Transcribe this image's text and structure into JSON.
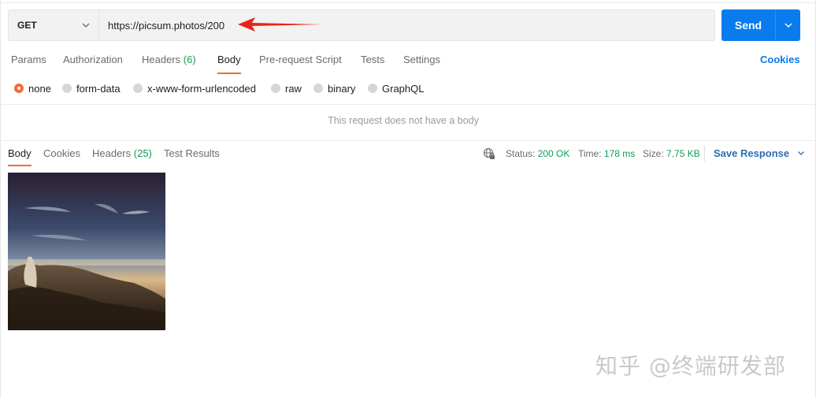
{
  "request": {
    "method": "GET",
    "url": "https://picsum.photos/200",
    "send_label": "Send"
  },
  "request_tabs": {
    "params": "Params",
    "authorization": "Authorization",
    "headers": "Headers",
    "headers_count": "(6)",
    "body": "Body",
    "prerequest": "Pre-request Script",
    "tests": "Tests",
    "settings": "Settings"
  },
  "cookies_link": "Cookies",
  "body_types": {
    "none": "none",
    "form_data": "form-data",
    "urlencoded": "x-www-form-urlencoded",
    "raw": "raw",
    "binary": "binary",
    "graphql": "GraphQL",
    "selected": "none"
  },
  "no_body_message": "This request does not have a body",
  "response_tabs": {
    "body": "Body",
    "cookies": "Cookies",
    "headers": "Headers",
    "headers_count": "(25)",
    "test_results": "Test Results"
  },
  "response_status": {
    "status_label": "Status:",
    "status_value": "200 OK",
    "time_label": "Time:",
    "time_value": "178 ms",
    "size_label": "Size:",
    "size_value": "7.75 KB",
    "save_response": "Save Response"
  },
  "watermark": "知乎 @终端研发部",
  "colors": {
    "accent": "#f26b3a",
    "send_button": "#097bed",
    "ok_green": "#0f9d58",
    "link_blue": "#097bed"
  }
}
